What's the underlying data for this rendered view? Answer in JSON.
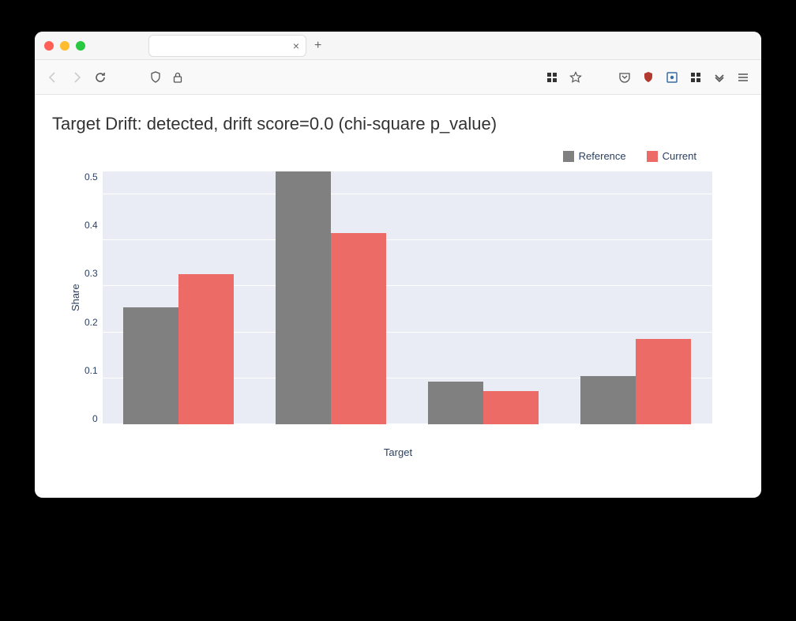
{
  "browser": {
    "tab_close": "×",
    "new_tab": "+"
  },
  "chart_data": {
    "type": "bar",
    "title": "Target Drift: detected, drift score=0.0 (chi-square p_value)",
    "xlabel": "Target",
    "ylabel": "Share",
    "ylim": [
      0,
      0.55
    ],
    "yticks": [
      "0",
      "0.1",
      "0.2",
      "0.3",
      "0.4",
      "0.5"
    ],
    "categories": [
      "",
      "",
      "",
      ""
    ],
    "series": [
      {
        "name": "Reference",
        "color": "#808080",
        "values": [
          0.255,
          0.55,
          0.092,
          0.105
        ]
      },
      {
        "name": "Current",
        "color": "#ed6b66",
        "values": [
          0.326,
          0.416,
          0.072,
          0.186
        ]
      }
    ]
  }
}
